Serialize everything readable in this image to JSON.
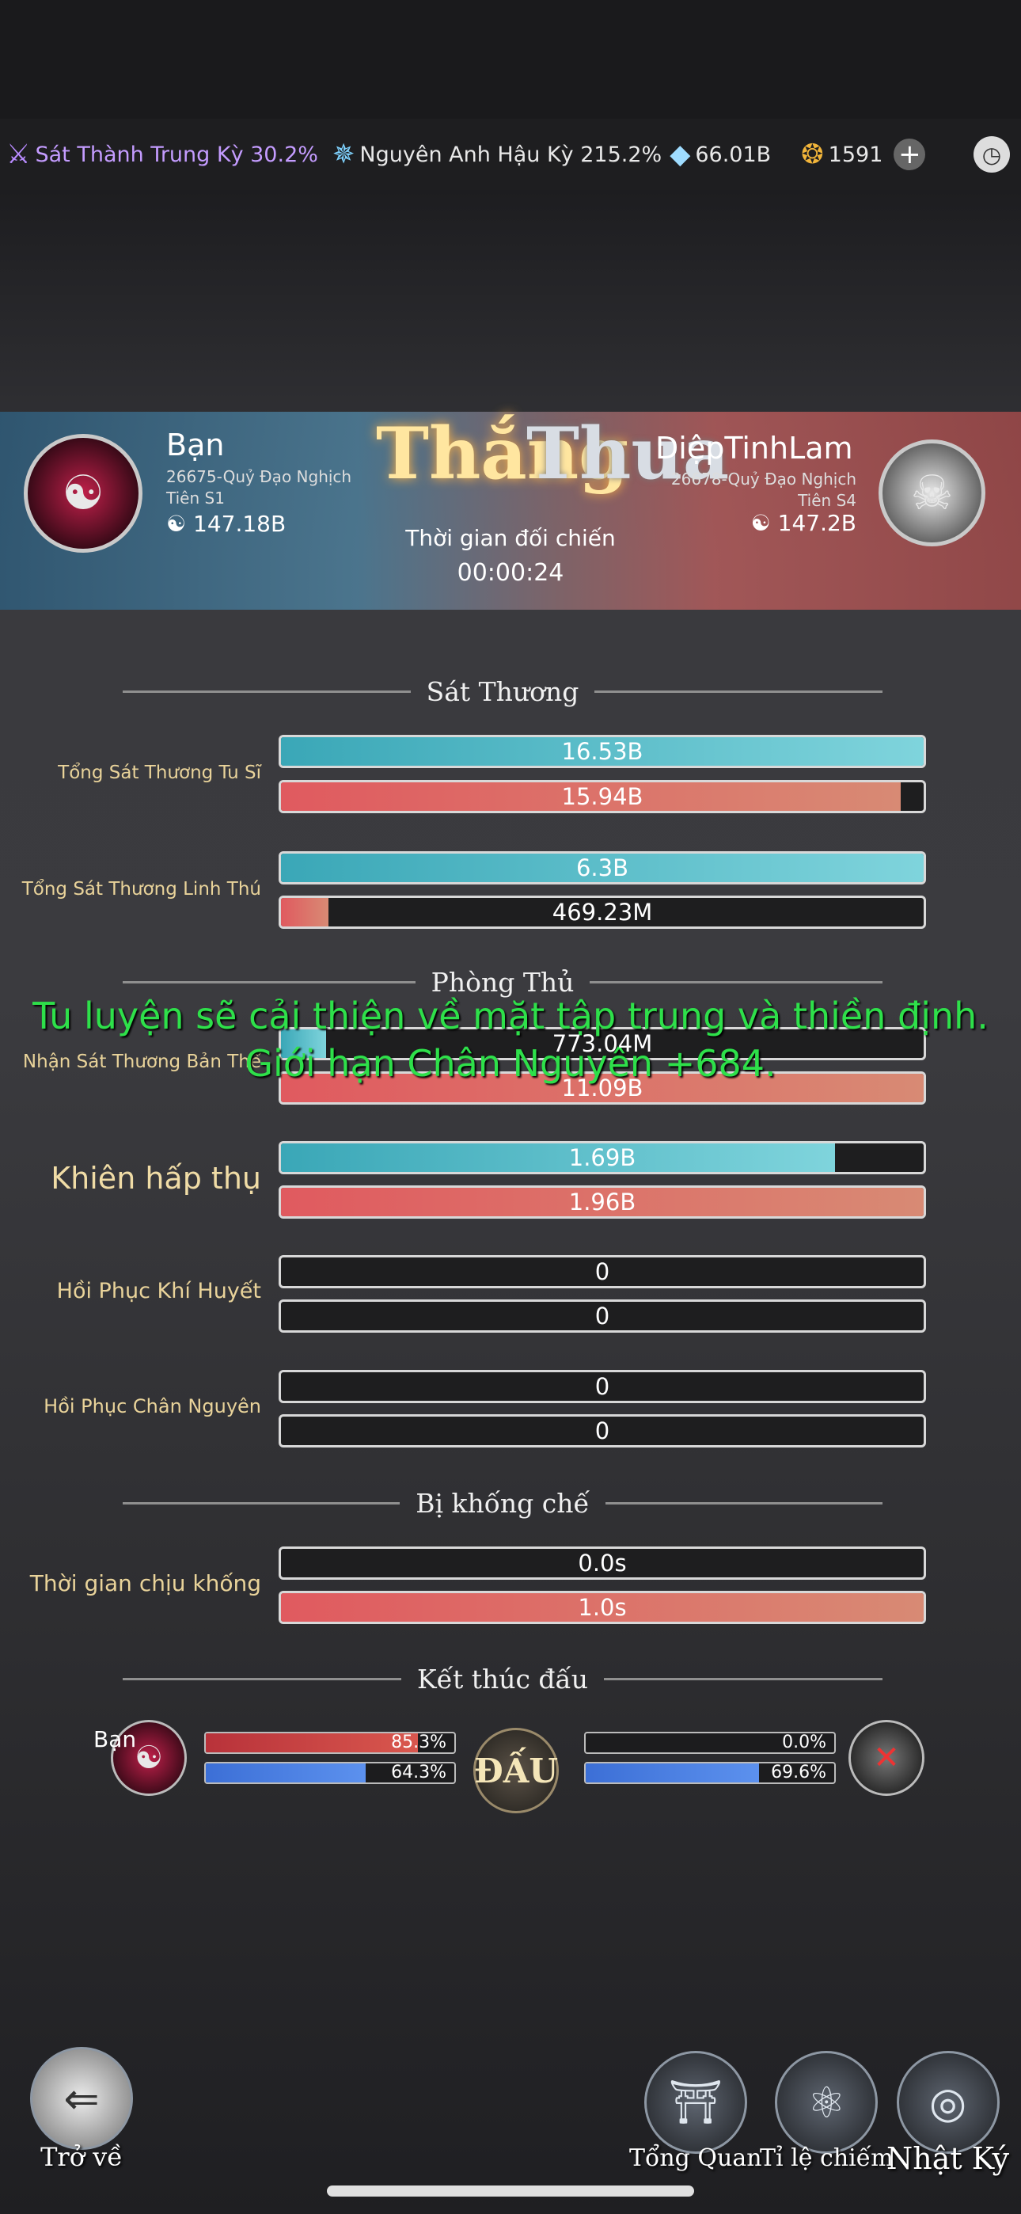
{
  "resources": {
    "realm1": "Sát Thành Trung Kỳ 30.2%",
    "realm2": "Nguyên Anh Hậu Kỳ 215.2%",
    "crystal": "66.01B",
    "coin": "1591",
    "realm1_color": "#c49cff"
  },
  "battle": {
    "player_name": "Bạn",
    "player_server": "26675-Quỷ Đạo Nghịch",
    "player_server2": "Tiên S1",
    "player_power": "147.18B",
    "result_win": "Thắng",
    "result_lose": "Thua",
    "enemy_name": "DiệpTinhLam",
    "enemy_server": "26678-Quỷ Đạo Nghịch",
    "enemy_server2": "Tiên S4",
    "enemy_power": "147.2B",
    "time_label": "Thời gian đối chiến",
    "time_value": "00:00:24"
  },
  "sections": {
    "damage": "Sát Thương",
    "defense": "Phòng Thủ",
    "control": "Bị khống chế",
    "end": "Kết thúc đấu"
  },
  "stats": {
    "cultivator_damage": {
      "label": "Tổng Sát Thương Tu Sĩ",
      "player": "16.53B",
      "enemy": "15.94B",
      "player_frac": 1.0,
      "enemy_frac": 0.964
    },
    "beast_damage": {
      "label": "Tổng Sát Thương Linh Thú",
      "player": "6.3B",
      "enemy": "469.23M",
      "player_frac": 1.0,
      "enemy_frac": 0.074
    },
    "damage_taken": {
      "label": "Nhận Sát Thương Bản Thể",
      "player": "773.04M",
      "enemy": "11.09B",
      "player_frac": 0.07,
      "enemy_frac": 1.0
    },
    "shield": {
      "label": "Khiên hấp thụ",
      "player": "1.69B",
      "enemy": "1.96B",
      "player_frac": 0.862,
      "enemy_frac": 1.0
    },
    "hp_heal": {
      "label": "Hồi Phục Khí Huyết",
      "player": "0",
      "enemy": "0",
      "player_frac": 0,
      "enemy_frac": 0
    },
    "mana_heal": {
      "label": "Hồi Phục Chân Nguyên",
      "player": "0",
      "enemy": "0",
      "player_frac": 0,
      "enemy_frac": 0
    },
    "cc_time": {
      "label": "Thời gian chịu khống",
      "player": "0.0s",
      "enemy": "1.0s",
      "player_frac": 0,
      "enemy_frac": 1.0
    }
  },
  "end_status": {
    "player_label": "Bạn",
    "player_hp": "85.3%",
    "player_hp_frac": 0.853,
    "player_mp": "64.3%",
    "player_mp_frac": 0.643,
    "enemy_hp": "0.0%",
    "enemy_hp_frac": 0.0,
    "enemy_mp": "69.6%",
    "enemy_mp_frac": 0.696,
    "fight_label": "ĐẤU"
  },
  "overlay": {
    "message": "Tu luyện sẽ cải thiện về mặt tập trung và thiền định. Giới hạn Chân Nguyên +684."
  },
  "nav": {
    "back": "Trở về",
    "overview": "Tổng Quan",
    "ratio": "Tỉ lệ chiếm",
    "log": "Nhật Ký"
  }
}
